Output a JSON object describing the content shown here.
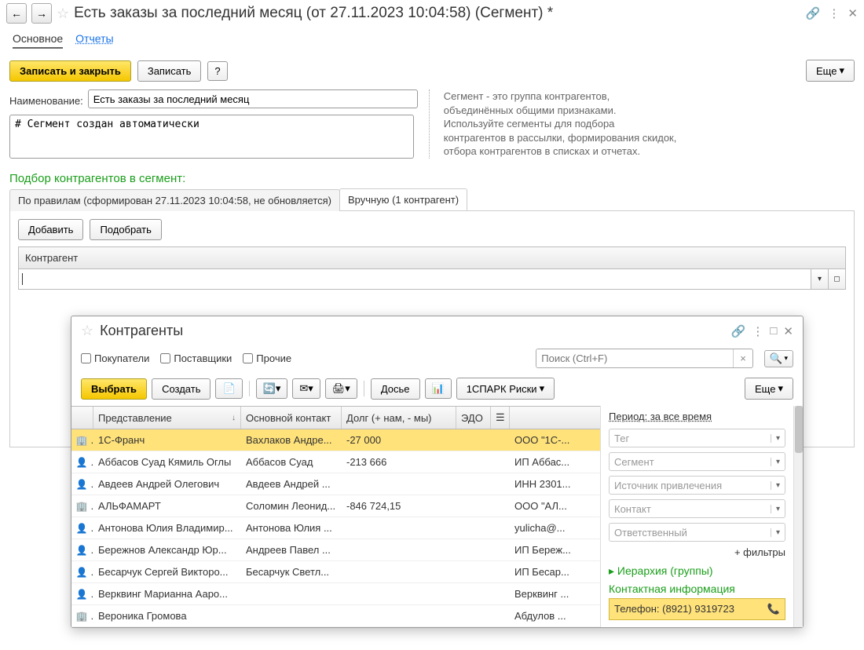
{
  "title": "Есть заказы за последний месяц (от 27.11.2023 10:04:58) (Сегмент) *",
  "mainTabs": {
    "t1": "Основное",
    "t2": "Отчеты"
  },
  "toolbar": {
    "saveClose": "Записать и закрыть",
    "save": "Записать",
    "help": "?",
    "more": "Еще"
  },
  "form": {
    "nameLabel": "Наименование:",
    "nameValue": "Есть заказы за последний месяц",
    "desc": "# Сегмент создан автоматически",
    "hint": "Сегмент - это группа контрагентов, объединённых общими признаками. Используйте сегменты для подбора контрагентов в рассылки, формирования скидок, отбора контрагентов в списках и отчетах."
  },
  "section": "Подбор контрагентов в сегмент:",
  "subtabs": {
    "rules": "По правилам (сформирован 27.11.2023 10:04:58, не обновляется)",
    "manual": "Вручную (1 контрагент)"
  },
  "panel": {
    "add": "Добавить",
    "pick": "Подобрать",
    "gridHeader": "Контрагент"
  },
  "dialog": {
    "title": "Контрагенты",
    "chk": {
      "buyers": "Покупатели",
      "suppliers": "Поставщики",
      "other": "Прочие"
    },
    "searchPlaceholder": "Поиск (Ctrl+F)",
    "btns": {
      "select": "Выбрать",
      "create": "Создать",
      "dossier": "Досье",
      "spark": "1СПАРК Риски",
      "more": "Еще"
    },
    "cols": {
      "c2": "Представление",
      "c3": "Основной контакт",
      "c4": "Долг (+ нам, - мы)",
      "c5": "ЭДО"
    },
    "rows": [
      {
        "ico": "b",
        "name": "1С-Франч",
        "contact": "Вахлаков Андре...",
        "debt": "-27 000",
        "edo": "",
        "ext": "ООО \"1С-..."
      },
      {
        "ico": "p",
        "name": "Аббасов Суад Кямиль Оглы",
        "contact": "Аббасов Суад",
        "debt": "-213 666",
        "edo": "",
        "ext": "ИП Аббас..."
      },
      {
        "ico": "p",
        "name": "Авдеев Андрей Олегович",
        "contact": "Авдеев Андрей ...",
        "debt": "",
        "edo": "",
        "ext": "ИНН 2301..."
      },
      {
        "ico": "b",
        "name": "АЛЬФАМАРТ",
        "contact": "Соломин Леонид...",
        "debt": "-846 724,15",
        "edo": "",
        "ext": "ООО \"АЛ..."
      },
      {
        "ico": "p",
        "name": "Антонова Юлия Владимир...",
        "contact": "Антонова Юлия ...",
        "debt": "",
        "edo": "",
        "ext": "yulicha@..."
      },
      {
        "ico": "p",
        "name": "Бережнов Александр Юр...",
        "contact": "Андреев Павел ...",
        "debt": "",
        "edo": "",
        "ext": "ИП Береж..."
      },
      {
        "ico": "p",
        "name": "Бесарчук Сергей Викторо...",
        "contact": "Бесарчук Светл...",
        "debt": "",
        "edo": "",
        "ext": "ИП Бесар..."
      },
      {
        "ico": "p",
        "name": "Верквинг Марианна Ааро...",
        "contact": "",
        "debt": "",
        "edo": "",
        "ext": "Верквинг ..."
      },
      {
        "ico": "b",
        "name": "Вероника Громова",
        "contact": "",
        "debt": "",
        "edo": "",
        "ext": "Абдулов ..."
      }
    ],
    "side": {
      "period": "Период: за все время",
      "filters": {
        "tag": "Тег",
        "segment": "Сегмент",
        "source": "Источник привлечения",
        "contact": "Контакт",
        "resp": "Ответственный"
      },
      "moreFilters": "+ фильтры",
      "hierarchy": "Иерархия (группы)",
      "contactInfo": "Контактная информация",
      "phone": "Телефон: (8921) 9319723"
    }
  }
}
